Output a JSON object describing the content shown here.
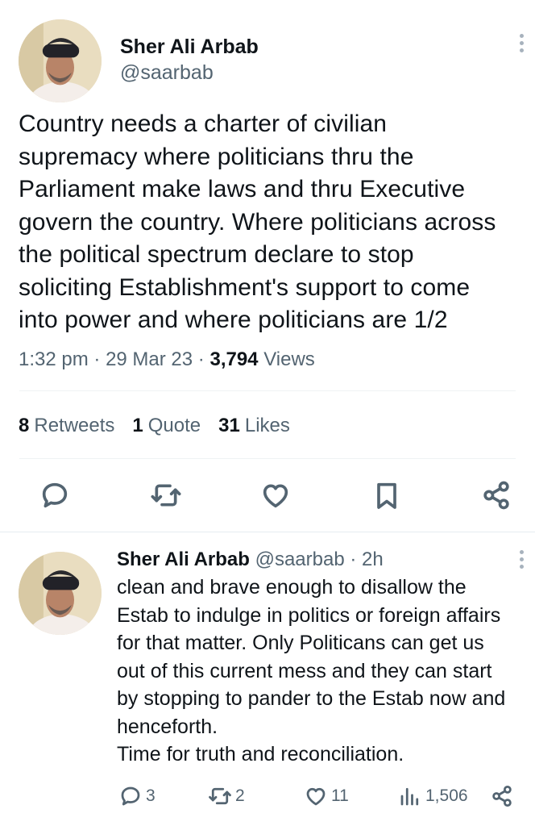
{
  "main_tweet": {
    "author_name": "Sher Ali Arbab",
    "author_handle": "@saarbab",
    "text": "Country needs a charter of civilian\nsupremacy where politicians thru the\nParliament make laws and thru Executive\ngovern the country. Where politicians across\nthe political spectrum declare to stop\nsoliciting Establishment's support to come\ninto power and where politicians are 1/2",
    "time": "1:32 pm",
    "date": "29 Mar 23",
    "views_count": "3,794",
    "views_label": "Views",
    "sep": "·",
    "retweets_count": "8",
    "retweets_label": "Retweets",
    "quotes_count": "1",
    "quotes_label": "Quote",
    "likes_count": "31",
    "likes_label": "Likes"
  },
  "reply_tweet": {
    "author_name": "Sher Ali Arbab",
    "author_handle": "@saarbab",
    "age": "· 2h",
    "text": "clean and brave enough to disallow the\nEstab to indulge in politics or foreign affairs\nfor that matter. Only Politicans can get us\nout of this current mess and they can start\nby stopping to pander to the Estab now and\nhenceforth.\nTime for truth and reconciliation.",
    "replies": "3",
    "retweets": "2",
    "likes": "11",
    "views": "1,506"
  },
  "icons": [
    "more-icon",
    "reply-icon",
    "retweet-icon",
    "like-icon",
    "bookmark-icon",
    "share-icon",
    "views-icon"
  ],
  "colors": {
    "text": "#0f1419",
    "secondary": "#536471",
    "divider": "#eff3f4"
  }
}
